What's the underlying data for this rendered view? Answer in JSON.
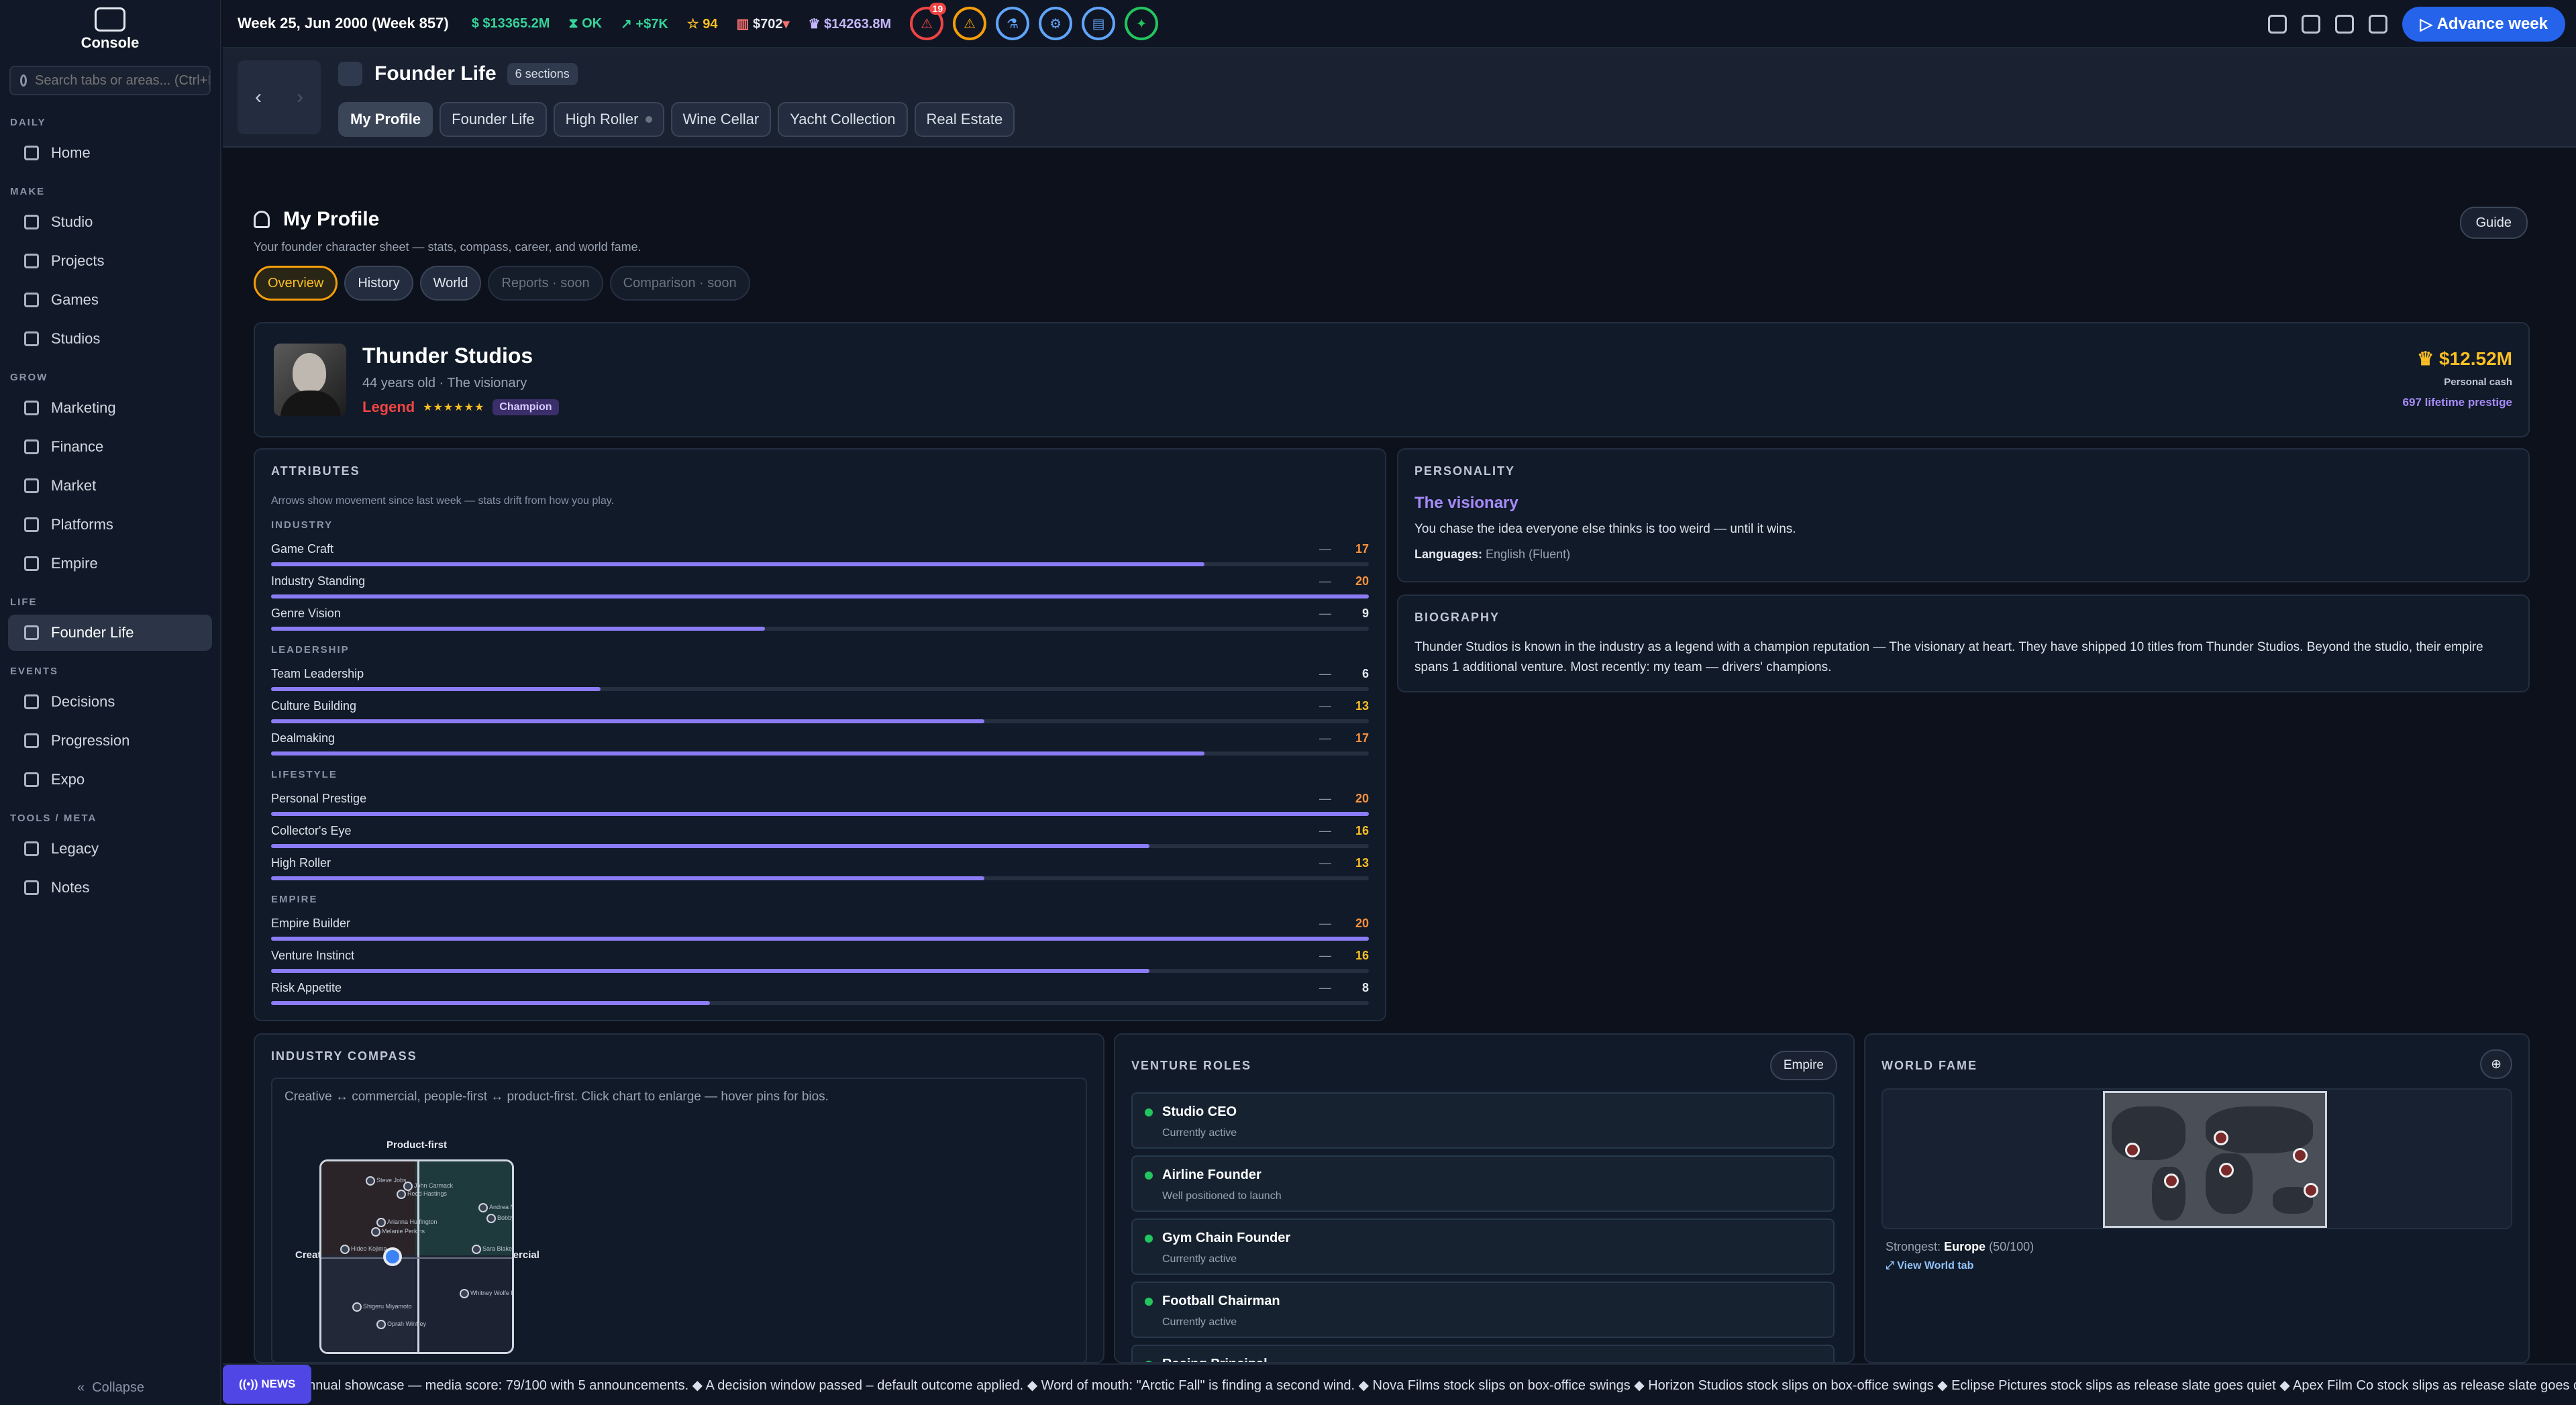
{
  "sidebar": {
    "logo": "Console",
    "search_placeholder": "Search tabs or areas... (Ctrl+K)",
    "groups": [
      {
        "label": "DAILY",
        "items": [
          {
            "label": "Home",
            "icon": "home-icon"
          }
        ]
      },
      {
        "label": "MAKE",
        "items": [
          {
            "label": "Studio",
            "icon": "studio-icon"
          },
          {
            "label": "Projects",
            "icon": "projects-icon"
          },
          {
            "label": "Games",
            "icon": "games-icon"
          },
          {
            "label": "Studios",
            "icon": "studios-icon"
          }
        ]
      },
      {
        "label": "GROW",
        "items": [
          {
            "label": "Marketing",
            "icon": "megaphone-icon"
          },
          {
            "label": "Finance",
            "icon": "bank-icon"
          },
          {
            "label": "Market",
            "icon": "globe-icon"
          },
          {
            "label": "Platforms",
            "icon": "grid-icon"
          },
          {
            "label": "Empire",
            "icon": "crown-icon"
          }
        ]
      },
      {
        "label": "LIFE",
        "items": [
          {
            "label": "Founder Life",
            "icon": "sparkles-icon",
            "active": true
          }
        ]
      },
      {
        "label": "EVENTS",
        "items": [
          {
            "label": "Decisions",
            "icon": "warning-icon"
          },
          {
            "label": "Progression",
            "icon": "flask-icon"
          },
          {
            "label": "Expo",
            "icon": "presentation-icon"
          }
        ]
      },
      {
        "label": "TOOLS / META",
        "items": [
          {
            "label": "Legacy",
            "icon": "book-icon"
          },
          {
            "label": "Notes",
            "icon": "notes-icon"
          }
        ]
      }
    ],
    "collapse": "Collapse"
  },
  "topbar": {
    "week": "Week 25, Jun 2000 (Week 857)",
    "cash": "$13365.2M",
    "status": "OK",
    "delta": "+$7K",
    "rating": "94",
    "price": "$702",
    "valuation": "$14263.8M",
    "alerts_count": "19",
    "advance": "Advance week",
    "colors": {
      "cash": "#34d399",
      "status": "#34d399",
      "delta": "#34d399",
      "rating": "#fbbf24",
      "price": "#e5e9f0",
      "valuation": "#c4b5fd"
    }
  },
  "header": {
    "title": "Founder Life",
    "sections": "6 sections",
    "tabs": [
      "My Profile",
      "Founder Life",
      "High Roller",
      "Wine Cellar",
      "Yacht Collection",
      "Real Estate"
    ]
  },
  "profile": {
    "title": "My Profile",
    "subtitle": "Your founder character sheet — stats, compass, career, and world fame.",
    "guide": "Guide",
    "subtabs": [
      "Overview",
      "History",
      "World",
      "Reports · soon",
      "Comparison · soon"
    ],
    "name": "Thunder Studios",
    "age_line": "44 years old · The visionary",
    "rank": "Legend",
    "stars": "★★★★★★",
    "badge": "Champion",
    "cash": "$12.52M",
    "cash_label": "Personal cash",
    "prestige": "697 lifetime prestige"
  },
  "attributes": {
    "heading": "ATTRIBUTES",
    "subtitle": "Arrows show movement since last week — stats drift from how you play.",
    "max": 20,
    "groups": [
      {
        "label": "INDUSTRY",
        "rows": [
          {
            "name": "Game Craft",
            "value": 17
          },
          {
            "name": "Industry Standing",
            "value": 20
          },
          {
            "name": "Genre Vision",
            "value": 9
          }
        ]
      },
      {
        "label": "LEADERSHIP",
        "rows": [
          {
            "name": "Team Leadership",
            "value": 6
          },
          {
            "name": "Culture Building",
            "value": 13
          },
          {
            "name": "Dealmaking",
            "value": 17
          }
        ]
      },
      {
        "label": "LIFESTYLE",
        "rows": [
          {
            "name": "Personal Prestige",
            "value": 20
          },
          {
            "name": "Collector's Eye",
            "value": 16
          },
          {
            "name": "High Roller",
            "value": 13
          }
        ]
      },
      {
        "label": "EMPIRE",
        "rows": [
          {
            "name": "Empire Builder",
            "value": 20
          },
          {
            "name": "Venture Instinct",
            "value": 16
          },
          {
            "name": "Risk Appetite",
            "value": 8
          }
        ]
      }
    ]
  },
  "personality": {
    "heading": "PERSONALITY",
    "name": "The visionary",
    "desc": "You chase the idea everyone else thinks is too weird — until it wins.",
    "lang_label": "Languages:",
    "lang_value": "English (Fluent)"
  },
  "biography": {
    "heading": "BIOGRAPHY",
    "text": "Thunder Studios is known in the industry as a legend with a champion reputation — The visionary at heart. They have shipped 10 titles from Thunder Studios. Beyond the studio, their empire spans 1 additional venture. Most recently: my team — drivers' champions."
  },
  "compass": {
    "heading": "INDUSTRY COMPASS",
    "desc": "Creative ↔ commercial, people-first ↔ product-first. Click chart to enlarge — hover pins for bios.",
    "top": "Product-first",
    "left": "Creative",
    "right": "Commercial",
    "pins": [
      "Steve Jobs",
      "John Carmack",
      "Reed Hastings",
      "Andrea Nossa",
      "Bobby Kotick",
      "Arianna Huffington",
      "Melanie Perkins",
      "Hideo Kojima",
      "Sara Blakely",
      "Whitney Wolfe Herd",
      "Shigeru Miyamoto",
      "Oprah Winfrey"
    ]
  },
  "ventures": {
    "heading": "VENTURE ROLES",
    "button": "Empire",
    "items": [
      {
        "name": "Studio CEO",
        "status": "Currently active"
      },
      {
        "name": "Airline Founder",
        "status": "Well positioned to launch"
      },
      {
        "name": "Gym Chain Founder",
        "status": "Currently active"
      },
      {
        "name": "Football Chairman",
        "status": "Currently active"
      },
      {
        "name": "Racing Principal",
        "status": ""
      }
    ]
  },
  "fame": {
    "heading": "WORLD FAME",
    "strongest_label": "Strongest:",
    "strongest_region": "Europe",
    "strongest_score": "(50/100)",
    "link": "View World tab"
  },
  "ticker": {
    "tag": "NEWS",
    "text": "annual showcase — media score: 79/100 with 5 announcements. ◆ A decision window passed – default outcome applied. ◆ Word of mouth: \"Arctic Fall\" is finding a second wind. ◆ Nova Films stock slips on box-office swings ◆ Horizon Studios stock slips on box-office swings ◆ Eclipse Pictures stock slips as release slate goes quiet ◆ Apex Film Co stock slips as release slate goes quiet ◆ Ardennes F"
  }
}
